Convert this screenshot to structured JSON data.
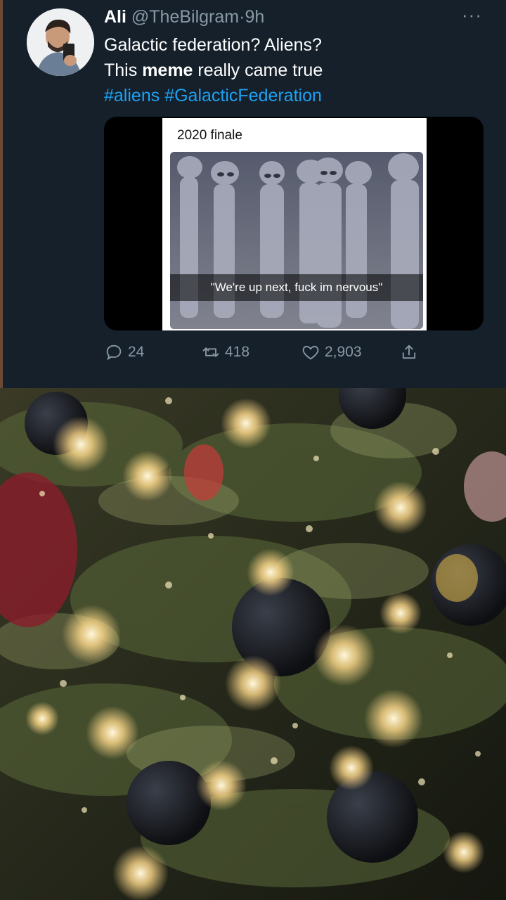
{
  "tweet": {
    "display_name": "Ali",
    "handle": "@TheBilgram",
    "separator": "·",
    "time": "9h",
    "more_label": "···",
    "text_line1": "Galactic federation? Aliens?",
    "text_line2_before": "This ",
    "text_line2_bold": "meme",
    "text_line2_after": " really came true",
    "hashtag1": "#aliens",
    "hashtag2": "#GalacticFederation",
    "media": {
      "caption_top": "2020 finale",
      "subtitle": "\"We're up next, fuck im nervous\""
    },
    "actions": {
      "replies": "24",
      "retweets": "418",
      "likes": "2,903"
    },
    "colors": {
      "background": "#15202b",
      "hashtag": "#1da1f2",
      "muted": "#8899a6"
    }
  },
  "icons": {
    "reply": "reply-icon",
    "retweet": "retweet-icon",
    "like": "heart-icon",
    "share": "share-icon"
  }
}
